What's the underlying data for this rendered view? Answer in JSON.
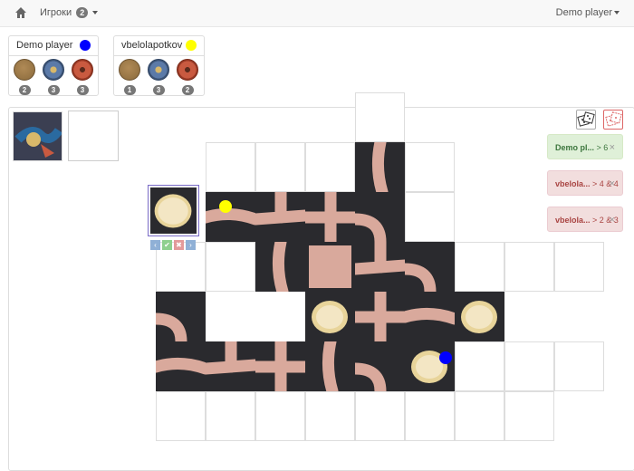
{
  "navbar": {
    "games_label": "Игроки",
    "games_count": "2",
    "user_label": "Demo player"
  },
  "players": [
    {
      "name": "Demo player",
      "color": "#0000ff",
      "items": [
        {
          "icon": "bronze-token",
          "count": "2"
        },
        {
          "icon": "blue-token",
          "count": "3"
        },
        {
          "icon": "red-token",
          "count": "3"
        }
      ]
    },
    {
      "name": "vbelolapotkov",
      "color": "#ffff00",
      "items": [
        {
          "icon": "bronze-token",
          "count": "1"
        },
        {
          "icon": "blue-token",
          "count": "3"
        },
        {
          "icon": "red-token",
          "count": "2"
        }
      ]
    }
  ],
  "tile_controls": [
    "‹",
    "✔",
    "✖",
    "›"
  ],
  "messages": [
    {
      "name": "Demo pl...",
      "text": " > 6",
      "status": "success"
    },
    {
      "name": "vbelola...",
      "text": " > 4 & 4",
      "status": "danger"
    },
    {
      "name": "vbelola...",
      "text": " > 2 & 3",
      "status": "danger"
    }
  ],
  "colors": {
    "player_blue": "#0000ff",
    "player_yellow": "#ffff00",
    "tile_floor": "#d9a99c",
    "tile_wall": "#2a2a2e"
  }
}
